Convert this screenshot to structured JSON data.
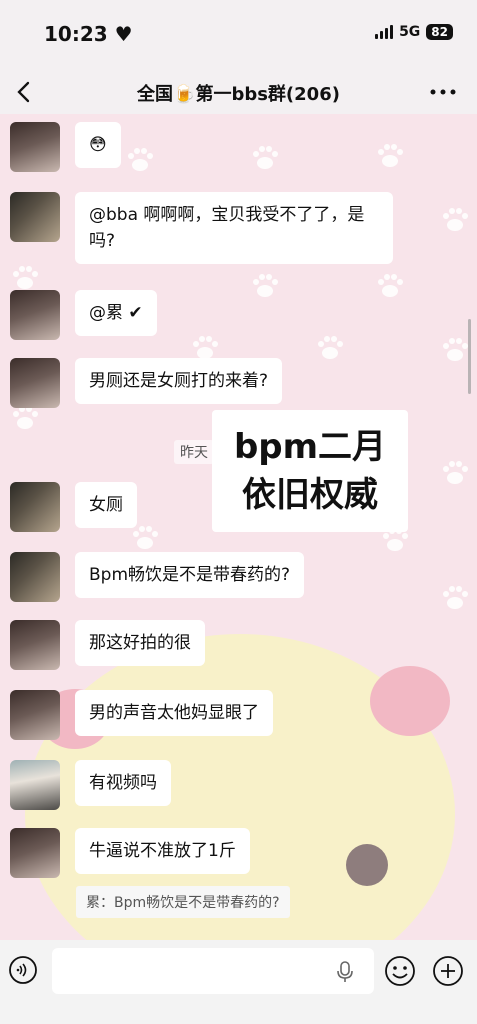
{
  "status_bar": {
    "time": "10:23",
    "network": "5G",
    "battery": "82"
  },
  "header": {
    "title": "全国🍺第一bbs群(206)"
  },
  "messages": [
    {
      "text": "😳",
      "avatar": "avatar-a"
    },
    {
      "text": "@bba 啊啊啊，宝贝我受不了了，是吗?",
      "avatar": "avatar-b"
    },
    {
      "text": "@累 ✔",
      "avatar": "avatar-a"
    },
    {
      "text": "男厕还是女厕打的来着?",
      "avatar": "avatar-a"
    },
    {
      "text": "女厕",
      "avatar": "avatar-b"
    },
    {
      "text": "Bpm畅饮是不是带春药的?",
      "avatar": "avatar-b"
    },
    {
      "text": "那这好拍的很",
      "avatar": "avatar-a"
    },
    {
      "text": "男的声音太他妈显眼了",
      "avatar": "avatar-a"
    },
    {
      "text": "有视频吗",
      "avatar": "avatar-c"
    },
    {
      "text": "牛逼说不准放了1斤",
      "avatar": "avatar-a"
    }
  ],
  "timestamp": "昨天",
  "overlay": {
    "line1": "bpm二月",
    "line2": "依旧权威"
  },
  "quote": "累：Bpm畅饮是不是带春药的?",
  "input": {
    "placeholder": ""
  },
  "icons": {
    "back": "back-chevron-icon",
    "more": "more-dots-icon",
    "voice": "voice-icon",
    "mic": "mic-icon",
    "emoji": "emoji-icon",
    "plus": "plus-icon"
  },
  "colors": {
    "chat_bg": "#f8e4ea",
    "bubble": "#ffffff",
    "paw": "#ffffff",
    "bar_bg": "#f3f3f3"
  }
}
